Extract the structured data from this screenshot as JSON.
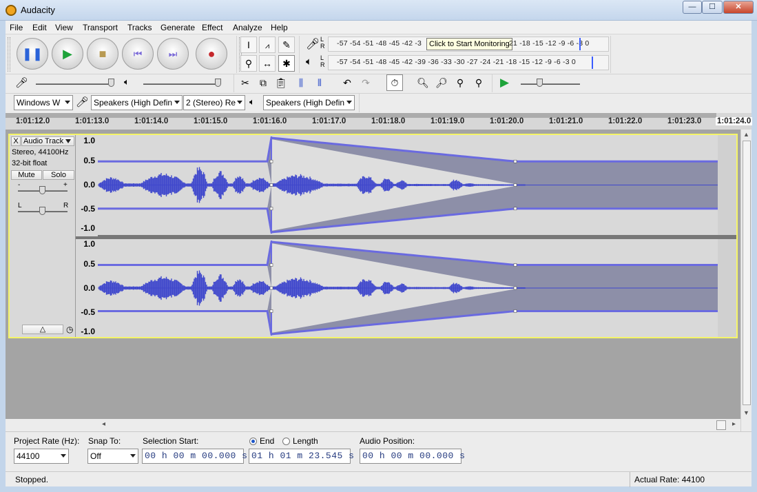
{
  "window": {
    "title": "Audacity",
    "min": "0",
    "max": "1",
    "close": "r"
  },
  "menu": [
    "File",
    "Edit",
    "View",
    "Transport",
    "Tracks",
    "Generate",
    "Effect",
    "Analyze",
    "Help"
  ],
  "meters": {
    "record_scale": "-57 -54 -51 -48 -45 -42 -3",
    "record_scale_right": "21 -18 -15 -12  -9   -6   -3   0",
    "tooltip": "Click to Start Monitoring",
    "play_scale": "-57 -54 -51 -48 -45 -42 -39 -36 -33 -30 -27 -24 -21 -18 -15 -12  -9   -6   -3   0",
    "lr_left": "L",
    "lr_right": "R"
  },
  "devices": {
    "host": "Windows W",
    "recording_device": "Speakers (High Defin",
    "channels": "2 (Stereo) Re",
    "playback_device": "Speakers (High Defin"
  },
  "ruler": [
    "1:01:12.0",
    "1:01:13.0",
    "1:01:14.0",
    "1:01:15.0",
    "1:01:16.0",
    "1:01:17.0",
    "1:01:18.0",
    "1:01:19.0",
    "1:01:20.0",
    "1:01:21.0",
    "1:01:22.0",
    "1:01:23.0",
    "1:01:24.0"
  ],
  "track": {
    "name": "Audio Track",
    "info1": "Stereo, 44100Hz",
    "info2": "32-bit float",
    "mute": "Mute",
    "solo": "Solo",
    "gain_minus": "-",
    "gain_plus": "+",
    "pan_l": "L",
    "pan_r": "R",
    "close": "X",
    "scale": [
      "1.0",
      "0.5",
      "0.0",
      "-0.5",
      "-1.0"
    ]
  },
  "selection_toolbar": {
    "project_rate_label": "Project Rate (Hz):",
    "project_rate": "44100",
    "snap_label": "Snap To:",
    "snap_value": "Off",
    "sel_start_label": "Selection Start:",
    "end_label": "End",
    "length_label": "Length",
    "audio_pos_label": "Audio Position:",
    "sel_start": "00 h 00 m 00.000 s",
    "sel_end": "01 h 01 m 23.545 s",
    "audio_pos": "00 h 00 m 00.000 s"
  },
  "status": {
    "left": "Stopped.",
    "right": "Actual Rate: 44100"
  },
  "colors": {
    "wave": "#3f47cc",
    "envelope": "#6a6ae0",
    "selection_border": "#f5f567"
  }
}
